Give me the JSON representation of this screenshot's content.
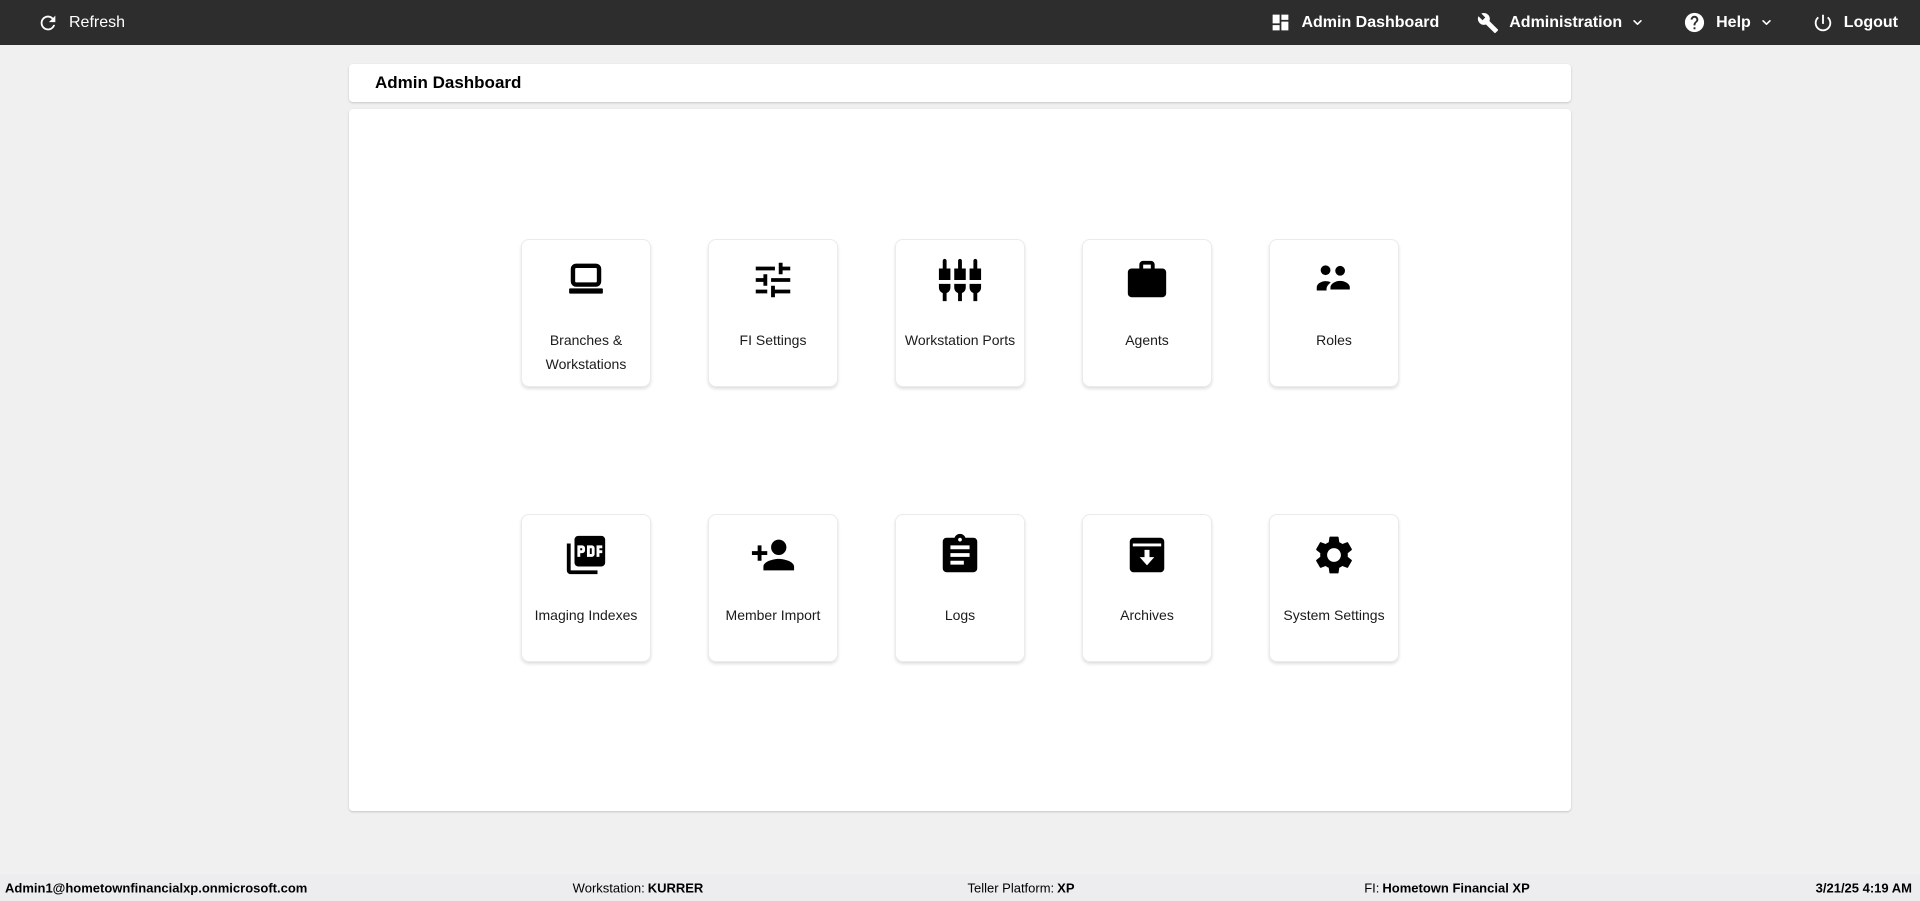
{
  "topbar": {
    "refresh_label": "Refresh",
    "nav": [
      {
        "label": "Admin Dashboard",
        "icon": "dashboard-icon",
        "has_dropdown": false
      },
      {
        "label": "Administration",
        "icon": "wrench-icon",
        "has_dropdown": true
      },
      {
        "label": "Help",
        "icon": "help-icon",
        "has_dropdown": true
      },
      {
        "label": "Logout",
        "icon": "power-icon",
        "has_dropdown": false
      }
    ]
  },
  "page": {
    "title": "Admin Dashboard"
  },
  "tiles": [
    {
      "name": "branches-workstations",
      "label": "Branches & Workstations",
      "icon": "laptop-icon"
    },
    {
      "name": "fi-settings",
      "label": "FI Settings",
      "icon": "sliders-icon"
    },
    {
      "name": "workstation-ports",
      "label": "Workstation Ports",
      "icon": "input-component-icon"
    },
    {
      "name": "agents",
      "label": "Agents",
      "icon": "briefcase-icon"
    },
    {
      "name": "roles",
      "label": "Roles",
      "icon": "people-icon"
    },
    {
      "name": "imaging-indexes",
      "label": "Imaging Indexes",
      "icon": "pdf-icon"
    },
    {
      "name": "member-import",
      "label": "Member Import",
      "icon": "person-add-icon"
    },
    {
      "name": "logs",
      "label": "Logs",
      "icon": "clipboard-icon"
    },
    {
      "name": "archives",
      "label": "Archives",
      "icon": "archive-icon"
    },
    {
      "name": "system-settings",
      "label": "System Settings",
      "icon": "gear-icon"
    }
  ],
  "footer": {
    "user": "Admin1@hometownfinancialxp.onmicrosoft.com",
    "workstation_label": "Workstation:",
    "workstation_value": "KURRER",
    "teller_platform_label": "Teller Platform:",
    "teller_platform_value": "XP",
    "fi_label": "FI:",
    "fi_value": "Hometown Financial XP",
    "datetime": "3/21/25 4:19 AM"
  },
  "colors": {
    "topbar_bg": "#2d2d2d",
    "topbar_text": "#ffffff",
    "page_bg": "#f0f0f0",
    "card_bg": "#ffffff",
    "footer_bg": "#ededf0",
    "icon_color": "#000000"
  }
}
